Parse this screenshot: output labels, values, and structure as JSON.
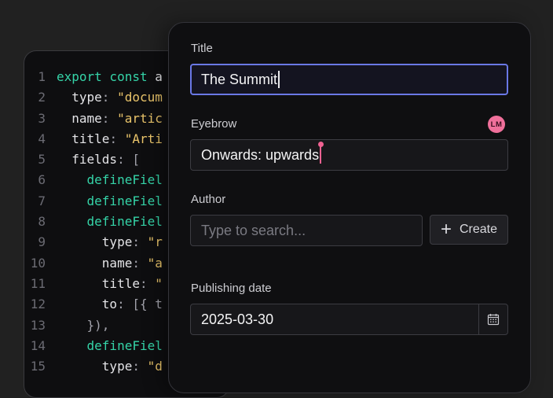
{
  "code": {
    "lines": [
      {
        "n": "1",
        "parts": [
          {
            "c": "kw",
            "t": "export const "
          },
          {
            "c": "key",
            "t": "a"
          }
        ]
      },
      {
        "n": "2",
        "parts": [
          {
            "c": "key",
            "t": "  type"
          },
          {
            "c": "pun",
            "t": ": "
          },
          {
            "c": "str",
            "t": "\"docum"
          }
        ]
      },
      {
        "n": "3",
        "parts": [
          {
            "c": "key",
            "t": "  name"
          },
          {
            "c": "pun",
            "t": ": "
          },
          {
            "c": "str",
            "t": "\"artic"
          }
        ]
      },
      {
        "n": "4",
        "parts": [
          {
            "c": "key",
            "t": "  title"
          },
          {
            "c": "pun",
            "t": ": "
          },
          {
            "c": "str",
            "t": "\"Arti"
          }
        ]
      },
      {
        "n": "5",
        "parts": [
          {
            "c": "key",
            "t": "  fields"
          },
          {
            "c": "pun",
            "t": ": ["
          }
        ]
      },
      {
        "n": "6",
        "parts": [
          {
            "c": "fn",
            "t": "    defineFiel"
          }
        ]
      },
      {
        "n": "7",
        "parts": [
          {
            "c": "fn",
            "t": "    defineFiel"
          }
        ]
      },
      {
        "n": "8",
        "parts": [
          {
            "c": "fn",
            "t": "    defineFiel"
          }
        ]
      },
      {
        "n": "9",
        "parts": [
          {
            "c": "key",
            "t": "      type"
          },
          {
            "c": "pun",
            "t": ": "
          },
          {
            "c": "str",
            "t": "\"r"
          }
        ]
      },
      {
        "n": "10",
        "parts": [
          {
            "c": "key",
            "t": "      name"
          },
          {
            "c": "pun",
            "t": ": "
          },
          {
            "c": "str",
            "t": "\"a"
          }
        ]
      },
      {
        "n": "11",
        "parts": [
          {
            "c": "key",
            "t": "      title"
          },
          {
            "c": "pun",
            "t": ": "
          },
          {
            "c": "str",
            "t": "\""
          }
        ]
      },
      {
        "n": "12",
        "parts": [
          {
            "c": "key",
            "t": "      to"
          },
          {
            "c": "pun",
            "t": ": [{ t"
          }
        ]
      },
      {
        "n": "13",
        "parts": [
          {
            "c": "pun",
            "t": "    }),"
          }
        ]
      },
      {
        "n": "14",
        "parts": [
          {
            "c": "fn",
            "t": "    defineFiel"
          }
        ]
      },
      {
        "n": "15",
        "parts": [
          {
            "c": "key",
            "t": "      type"
          },
          {
            "c": "pun",
            "t": ": "
          },
          {
            "c": "str",
            "t": "\"d"
          }
        ]
      }
    ]
  },
  "form": {
    "title": {
      "label": "Title",
      "value": "The Summit"
    },
    "eyebrow": {
      "label": "Eyebrow",
      "value": "Onwards: upwards",
      "avatar_initials": "LM"
    },
    "author": {
      "label": "Author",
      "placeholder": "Type to search...",
      "create_label": "Create"
    },
    "publishing_date": {
      "label": "Publishing date",
      "value": "2025-03-30"
    }
  },
  "colors": {
    "accent": "#6a78e6",
    "presence": "#f06292",
    "keyword": "#35d4a8",
    "string": "#e9c46a"
  },
  "icons": {
    "create": "plus-icon",
    "date_picker": "calendar-icon"
  }
}
